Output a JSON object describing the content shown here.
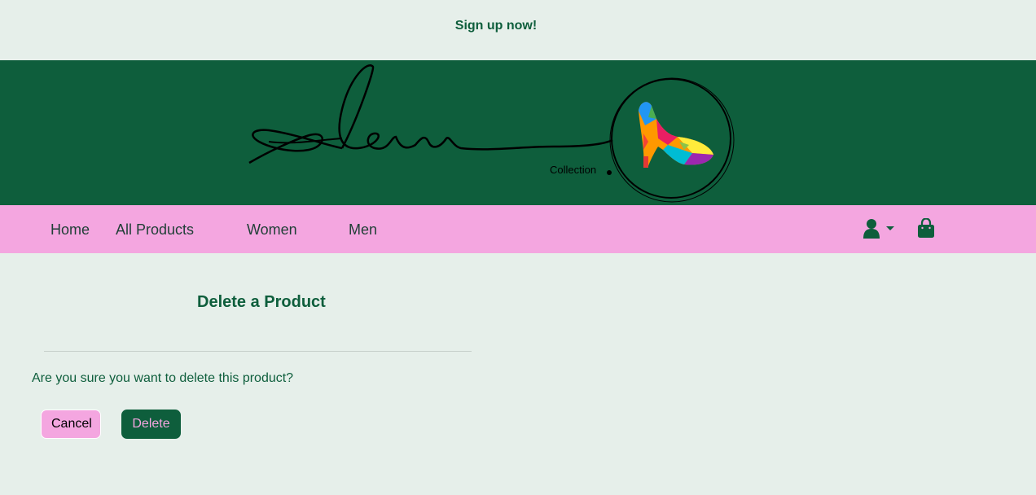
{
  "promo": {
    "signup_label": "Sign up now!"
  },
  "banner": {
    "logo_caption": "Collection"
  },
  "nav": {
    "links": [
      {
        "label": "Home"
      },
      {
        "label": "All Products"
      },
      {
        "label": "Women"
      },
      {
        "label": "Men"
      }
    ],
    "account_icon": "user-icon",
    "bag_icon": "shopping-bag-icon"
  },
  "main": {
    "title": "Delete a Product",
    "confirm_text": "Are you sure you want to delete this product?",
    "cancel_label": "Cancel",
    "delete_label": "Delete"
  },
  "colors": {
    "page_bg": "#e6efea",
    "brand_green": "#0e5e3c",
    "nav_pink": "#f4a6e0"
  }
}
